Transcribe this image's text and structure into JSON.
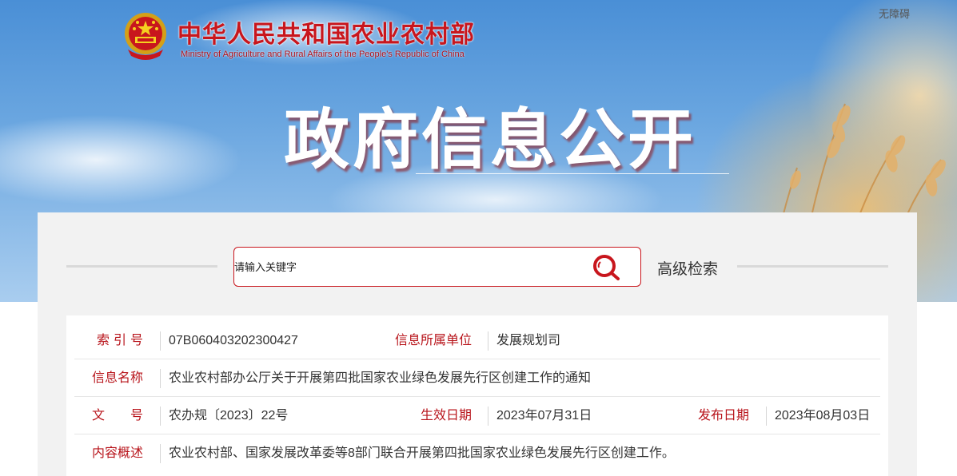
{
  "header": {
    "ministry_cn": "中华人民共和国农业农村部",
    "ministry_en": "Ministry of Agriculture and Rural Affairs of the People's Republic of China",
    "accessibility": "无障碍",
    "hero_title": "政府信息公开"
  },
  "search": {
    "placeholder": "请输入关键字",
    "advanced": "高级检索",
    "button_icon": "search-icon"
  },
  "info": {
    "index_label": "索引号",
    "index_value": "07B060403202300427",
    "unit_label": "信息所属单位",
    "unit_value": "发展规划司",
    "name_label": "信息名称",
    "name_value": "农业农村部办公厅关于开展第四批国家农业绿色发展先行区创建工作的通知",
    "doc_label": "文号",
    "doc_value": "农办规〔2023〕22号",
    "effective_label": "生效日期",
    "effective_value": "2023年07月31日",
    "publish_label": "发布日期",
    "publish_value": "2023年08月03日",
    "summary_label": "内容概述",
    "summary_value": "农业农村部、国家发展改革委等8部门联合开展第四批国家农业绿色发展先行区创建工作。"
  },
  "colors": {
    "brand_red": "#c8161d",
    "label_red": "#b8141b",
    "sky_blue": "#4a8fd6"
  }
}
